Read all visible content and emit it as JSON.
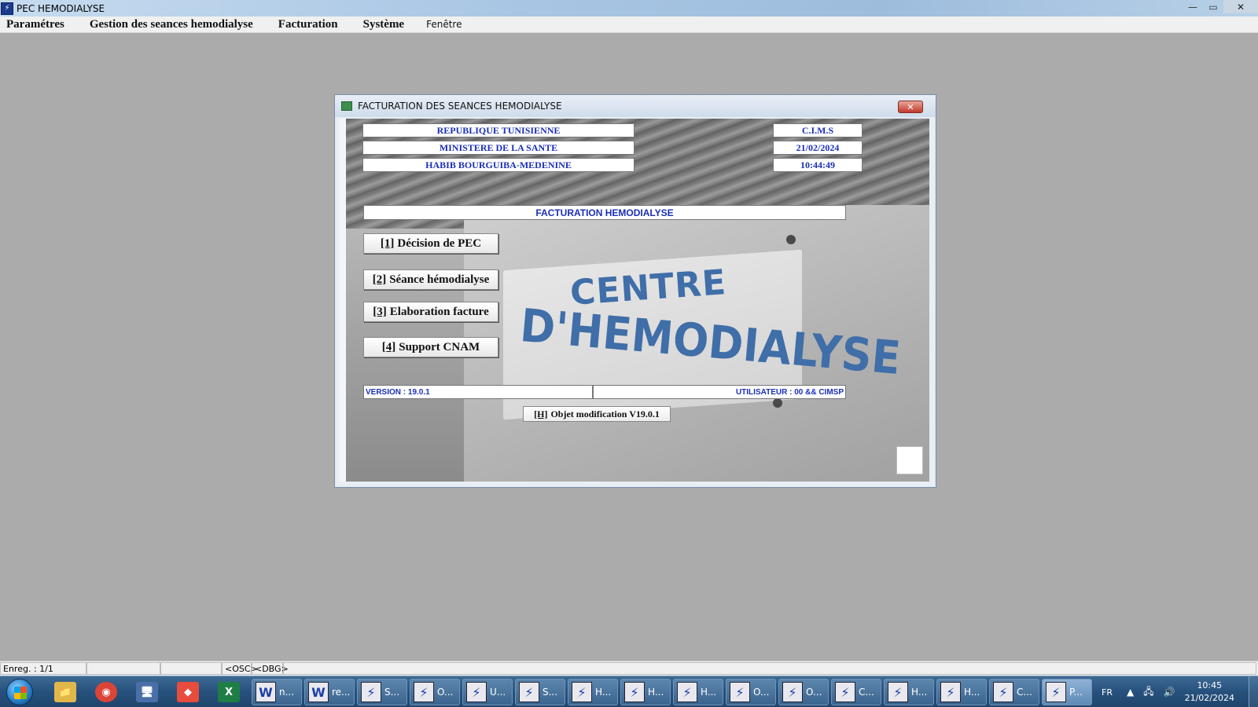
{
  "app": {
    "title": "PEC HEMODIALYSE",
    "icon": "app-icon"
  },
  "window_controls": {
    "minimize": "—",
    "restore": "▭",
    "close": "✕"
  },
  "menubar": {
    "items": [
      {
        "label": "Paramétres"
      },
      {
        "label": "Gestion des seances hemodialyse"
      },
      {
        "label": "Facturation"
      },
      {
        "label": "Système"
      },
      {
        "label": "Fenêtre"
      }
    ]
  },
  "dialog": {
    "title": "FACTURATION DES SEANCES HEMODIALYSE",
    "close_glyph": "✕",
    "header_left": [
      "REPUBLIQUE TUNISIENNE",
      "MINISTERE DE LA SANTE",
      "HABIB BOURGUIBA-MEDENINE"
    ],
    "header_right": [
      "C.I.M.S",
      "21/02/2024",
      "10:44:49"
    ],
    "banner": "FACTURATION HEMODIALYSE",
    "sign": {
      "line1": "CENTRE",
      "line2": "D'HEMODIALYSE"
    },
    "buttons": [
      {
        "key": "[1]",
        "label": "Décision de PEC"
      },
      {
        "key": "[2]",
        "label": "Séance hémodialyse"
      },
      {
        "key": "[3]",
        "label": "Elaboration facture"
      },
      {
        "key": "[4]",
        "label": "Support CNAM"
      }
    ],
    "version": "VERSION : 19.0.1",
    "user": "UTILISATEUR : 00 && CIMSP",
    "object_button": {
      "key": "[H]",
      "label": "Objet modification V19.0.1"
    }
  },
  "statusbar": {
    "record": "Enreg. : 1/1",
    "osc": "<OSC>",
    "dbg": "<DBG>"
  },
  "taskbar": {
    "pinned": [
      {
        "name": "explorer-icon",
        "glyph": "📁",
        "color": "#e0b84a"
      },
      {
        "name": "chrome-icon",
        "glyph": "◉",
        "color": "#db4437"
      },
      {
        "name": "remote-desktop-icon",
        "glyph": "🖥",
        "color": "#4a6fa8"
      },
      {
        "name": "anydesk-icon",
        "glyph": "◆",
        "color": "#e74c3c"
      },
      {
        "name": "excel-icon",
        "glyph": "X",
        "color": "#1e7e45"
      }
    ],
    "tasks": [
      {
        "label": "n...",
        "icon": "word-icon"
      },
      {
        "label": "re...",
        "icon": "word-icon"
      },
      {
        "label": "S...",
        "icon": "app-icon"
      },
      {
        "label": "O...",
        "icon": "app-icon"
      },
      {
        "label": "U...",
        "icon": "app-icon"
      },
      {
        "label": "S...",
        "icon": "app-icon"
      },
      {
        "label": "H...",
        "icon": "app-icon"
      },
      {
        "label": "H...",
        "icon": "app-icon"
      },
      {
        "label": "H...",
        "icon": "app-icon"
      },
      {
        "label": "O...",
        "icon": "app-icon"
      },
      {
        "label": "O...",
        "icon": "app-icon"
      },
      {
        "label": "C...",
        "icon": "app-icon"
      },
      {
        "label": "H...",
        "icon": "app-icon"
      },
      {
        "label": "H...",
        "icon": "app-icon"
      },
      {
        "label": "C...",
        "icon": "app-icon"
      },
      {
        "label": "P...",
        "icon": "app-icon"
      }
    ],
    "tray": {
      "lang": "FR",
      "time": "10:45",
      "date": "21/02/2024"
    }
  }
}
